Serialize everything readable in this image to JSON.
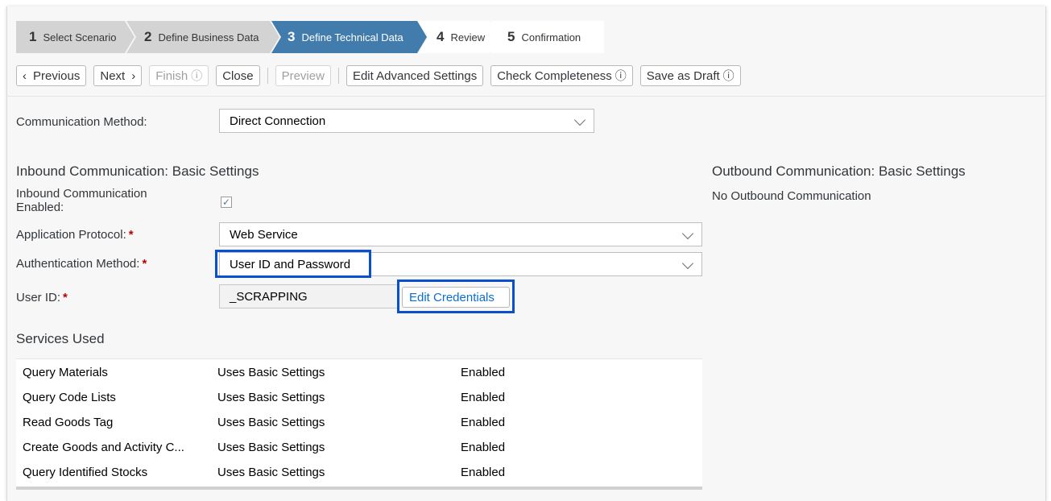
{
  "steps": [
    {
      "num": "1",
      "label": "Select Scenario"
    },
    {
      "num": "2",
      "label": "Define Business Data"
    },
    {
      "num": "3",
      "label": "Define Technical Data"
    },
    {
      "num": "4",
      "label": "Review"
    },
    {
      "num": "5",
      "label": "Confirmation"
    }
  ],
  "toolbar": {
    "previous": "Previous",
    "next": "Next",
    "finish": "Finish",
    "close": "Close",
    "preview": "Preview",
    "edit_advanced": "Edit Advanced Settings",
    "check_completeness": "Check Completeness",
    "save_draft": "Save as Draft",
    "help_glyph": "?"
  },
  "form": {
    "comm_method_label": "Communication Method:",
    "comm_method_value": "Direct Connection",
    "inbound_title": "Inbound Communication: Basic Settings",
    "inbound_enabled_label_1": "Inbound Communication",
    "inbound_enabled_label_2": "Enabled:",
    "inbound_enabled_checked": true,
    "app_protocol_label": "Application Protocol:",
    "app_protocol_value": "Web Service",
    "auth_method_label": "Authentication Method:",
    "auth_method_value": "User ID and Password",
    "user_id_label": "User ID:",
    "user_id_value": "_SCRAPPING",
    "edit_credentials": "Edit Credentials",
    "required_mark": "*"
  },
  "outbound": {
    "title": "Outbound Communication: Basic Settings",
    "status": "No Outbound Communication"
  },
  "services": {
    "title": "Services Used",
    "rows": [
      {
        "name": "Query Materials",
        "settings": "Uses Basic Settings",
        "status": "Enabled"
      },
      {
        "name": "Query Code Lists",
        "settings": "Uses Basic Settings",
        "status": "Enabled"
      },
      {
        "name": "Read Goods Tag",
        "settings": "Uses Basic Settings",
        "status": "Enabled"
      },
      {
        "name": "Create Goods and Activity C...",
        "settings": "Uses Basic Settings",
        "status": "Enabled"
      },
      {
        "name": "Query Identified Stocks",
        "settings": "Uses Basic Settings",
        "status": "Enabled"
      }
    ]
  },
  "colors": {
    "active_step": "#427cac",
    "completed_step": "#d3d3d3",
    "highlight_box": "#0b4fd1",
    "required": "#bb0000",
    "link": "#0a6ed1"
  }
}
